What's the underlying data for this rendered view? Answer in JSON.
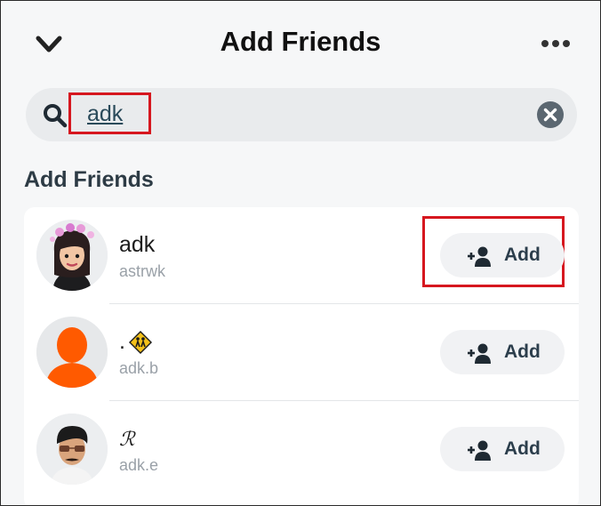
{
  "header": {
    "title": "Add Friends",
    "back_icon": "chevron-down-icon",
    "more_icon": "more-horizontal-icon"
  },
  "search": {
    "value": "adk",
    "search_icon": "search-icon",
    "clear_icon": "clear-icon"
  },
  "section": {
    "title": "Add Friends"
  },
  "friends": [
    {
      "display_name": "adk",
      "username": "astrwk",
      "add_label": "Add",
      "avatar": "bitmoji-woman-avatar"
    },
    {
      "display_name": ".",
      "username": "adk.b",
      "add_label": "Add",
      "avatar": "default-silhouette-avatar",
      "badge": "school-crossing-emoji"
    },
    {
      "display_name": "ℛ",
      "username": "adk.e",
      "add_label": "Add",
      "avatar": "bitmoji-man-avatar"
    }
  ],
  "colors": {
    "highlight": "#d6171f",
    "default_avatar": "#ff5a00",
    "username": "#9aa1a8"
  }
}
